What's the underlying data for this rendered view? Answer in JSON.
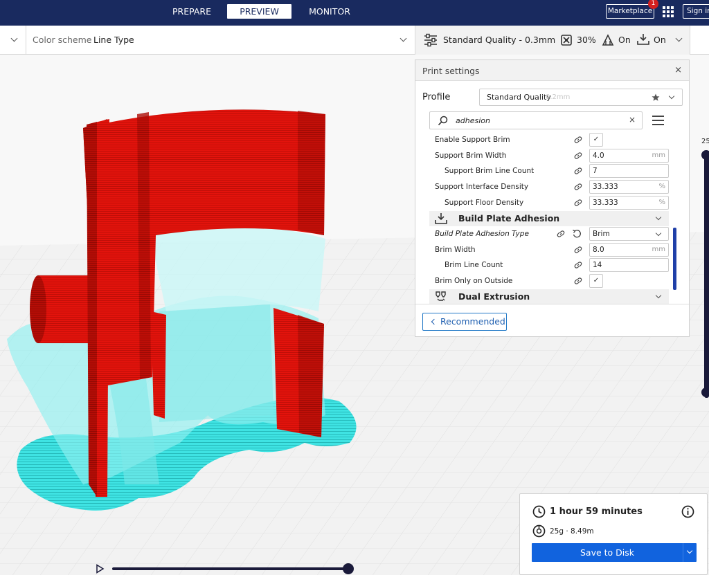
{
  "stages": {
    "prepare": "PREPARE",
    "preview": "PREVIEW",
    "monitor": "MONITOR"
  },
  "header": {
    "marketplace_label": "Marketplace",
    "marketplace_badge": "1",
    "signin_label": "Sign in"
  },
  "subbar": {
    "color_scheme_label": "Color scheme",
    "color_scheme_value": "Line Type",
    "quality": "Standard Quality - 0.3mm",
    "infill": "30%",
    "support": "On",
    "adhesion": "On"
  },
  "print_settings": {
    "title": "Print settings",
    "close": "×",
    "profile_label": "Profile",
    "profile_name": "Standard Quality",
    "profile_sub": "0.2mm",
    "search_value": "adhesion",
    "search_clear": "×",
    "rows": [
      {
        "label": "Enable Support Brim",
        "check": "✓"
      },
      {
        "label": "Support Brim Width",
        "value": "4.0",
        "unit": "mm"
      },
      {
        "label": "Support Brim Line Count",
        "value": "7",
        "unit": ""
      },
      {
        "label": "Support Interface Density",
        "value": "33.333",
        "unit": "%"
      },
      {
        "label": "Support Floor Density",
        "value": "33.333",
        "unit": "%"
      }
    ],
    "section_adhesion": "Build Plate Adhesion",
    "adhesion_rows": [
      {
        "label": "Build Plate Adhesion Type",
        "value": "Brim"
      },
      {
        "label": "Brim Width",
        "value": "8.0",
        "unit": "mm"
      },
      {
        "label": "Brim Line Count",
        "value": "14",
        "unit": ""
      },
      {
        "label": "Brim Only on Outside",
        "check": "✓"
      }
    ],
    "section_dual": "Dual Extrusion",
    "recommended_label": "Recommended"
  },
  "layer": {
    "number": "25"
  },
  "output": {
    "time": "1 hour 59 minutes",
    "material": "25g · 8.49m",
    "save_label": "Save to Disk"
  },
  "colors": {
    "header_bg": "#192a5f",
    "accent_blue": "#1163de",
    "model_red": "#e8120b",
    "support_cyan": "#3fe6e6"
  }
}
